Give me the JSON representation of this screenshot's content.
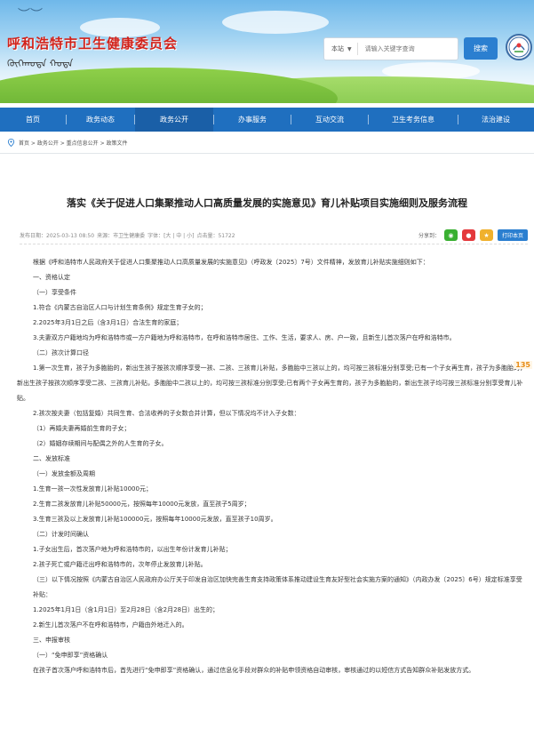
{
  "header": {
    "site_title": "呼和浩特市卫生健康委员会",
    "mongol_text": "ᠬᠥᠬᠡᠬᠣᠲᠠ ᠬᠣᠲᠠ",
    "search": {
      "scope": "本站",
      "placeholder": "请输入关键字查询",
      "button": "搜索"
    }
  },
  "nav": [
    "首页",
    "政务动态",
    "政务公开",
    "办事服务",
    "互动交流",
    "卫生考务信息",
    "法治建设"
  ],
  "nav_active_index": 2,
  "breadcrumb": "首页 > 政务公开 > 重点信息公开 > 政策文件",
  "article": {
    "title": "落实《关于促进人口集聚推动人口高质量发展的实施意见》育儿补贴项目实施细则及服务流程",
    "meta": {
      "date": "发布日期：2025-03-13 08:50",
      "source": "来源：市卫生健康委",
      "font": "字体：[大 | 中 | 小]",
      "views": "点击量：51722"
    },
    "share_label": "分享到：",
    "print_label": "打印本页",
    "side_badge": "135",
    "paragraphs": [
      {
        "t": "根据《呼和浩特市人民政府关于促进人口集聚推动人口高质量发展的实施意见》（呼政发〔2025〕7号）文件精神，发放育儿补贴实施细则如下：",
        "wrap": false
      },
      {
        "t": "一、资格认定",
        "wrap": false
      },
      {
        "t": "（一）享受条件",
        "wrap": false
      },
      {
        "t": "1.符合《内蒙古自治区人口与计划生育条例》规定生育子女的；",
        "wrap": false
      },
      {
        "t": "2.2025年3月1日之后（含3月1日）合法生育的家庭；",
        "wrap": false
      },
      {
        "t": "3.夫妻双方户籍地均为呼和浩特市或一方户籍地为呼和浩特市，在呼和浩特市居住、工作、生活，要求人、房、户一致，且新生儿首次落户在呼和浩特市。",
        "wrap": false
      },
      {
        "t": "（二）孩次计算口径",
        "wrap": false
      },
      {
        "t": "1.第一次生育，孩子为多胞胎的，新出生孩子按孩次顺序享受一孩、二孩、三孩育儿补贴，多胞胎中三孩以上的，均可按三孩标准分别享受;已有一个子女再生育，孩子为多胞胎的，新出生孩子按孩次顺序享受二孩、三孩育儿补贴，多胞胎中二孩以上的，均可按三孩标准分别享受;已有两个子女再生育的，孩子为多胞胎的，新出生孩子均可按三孩标准分别享受育儿补贴。",
        "wrap": true
      },
      {
        "t": "2.孩次按夫妻（包括复婚）共同生育、合法收养的子女数合并计算，但以下情况均不计入子女数：",
        "wrap": false
      },
      {
        "t": "（1）再婚夫妻再婚前生育的子女；",
        "wrap": false
      },
      {
        "t": "（2）婚姻存续期间与配偶之外的人生育的子女。",
        "wrap": false
      },
      {
        "t": "二、发放标准",
        "wrap": false
      },
      {
        "t": "（一）发放金额及周期",
        "wrap": false
      },
      {
        "t": "1.生育一孩一次性发放育儿补贴10000元；",
        "wrap": false
      },
      {
        "t": "2.生育二孩发放育儿补贴50000元，按照每年10000元发放，直至孩子5周岁；",
        "wrap": false
      },
      {
        "t": "3.生育三孩及以上发放育儿补贴100000元，按照每年10000元发放，直至孩子10周岁。",
        "wrap": false
      },
      {
        "t": "（二）计发时间确认",
        "wrap": false
      },
      {
        "t": "1.子女出生后，首次落户地为呼和浩特市的，以出生年份计发育儿补贴；",
        "wrap": false
      },
      {
        "t": "2.孩子死亡或户籍迁出呼和浩特市的，次年停止发放育儿补贴。",
        "wrap": false
      },
      {
        "t": "（三）以下情况按照《内蒙古自治区人民政府办公厅关于印发自治区加快完善生育支持政策体系推动建设生育友好型社会实施方案的通知》（内政办发〔2025〕6号）规定标准享受补贴：",
        "wrap": false
      },
      {
        "t": "1.2025年1月1日（含1月1日）至2月28日（含2月28日）出生的；",
        "wrap": false
      },
      {
        "t": "2.新生儿首次落户不在呼和浩特市，户籍由外地迁入的。",
        "wrap": false
      },
      {
        "t": "三、申报审核",
        "wrap": false
      },
      {
        "t": "（一）“免申即享”资格确认",
        "wrap": false
      },
      {
        "t": "在孩子首次落户呼和浩特市后，首先进行“免申即享”资格确认，通过信息化手段对群众的补贴申领资格自动审核，审核通过的以短信方式告知群众补贴发放方式。",
        "wrap": true
      }
    ]
  },
  "colors": {
    "nav_bg": "#1f6fbf",
    "nav_active": "#1a5fa7",
    "title_red": "#d0221b",
    "button_blue": "#2b7fd0"
  }
}
